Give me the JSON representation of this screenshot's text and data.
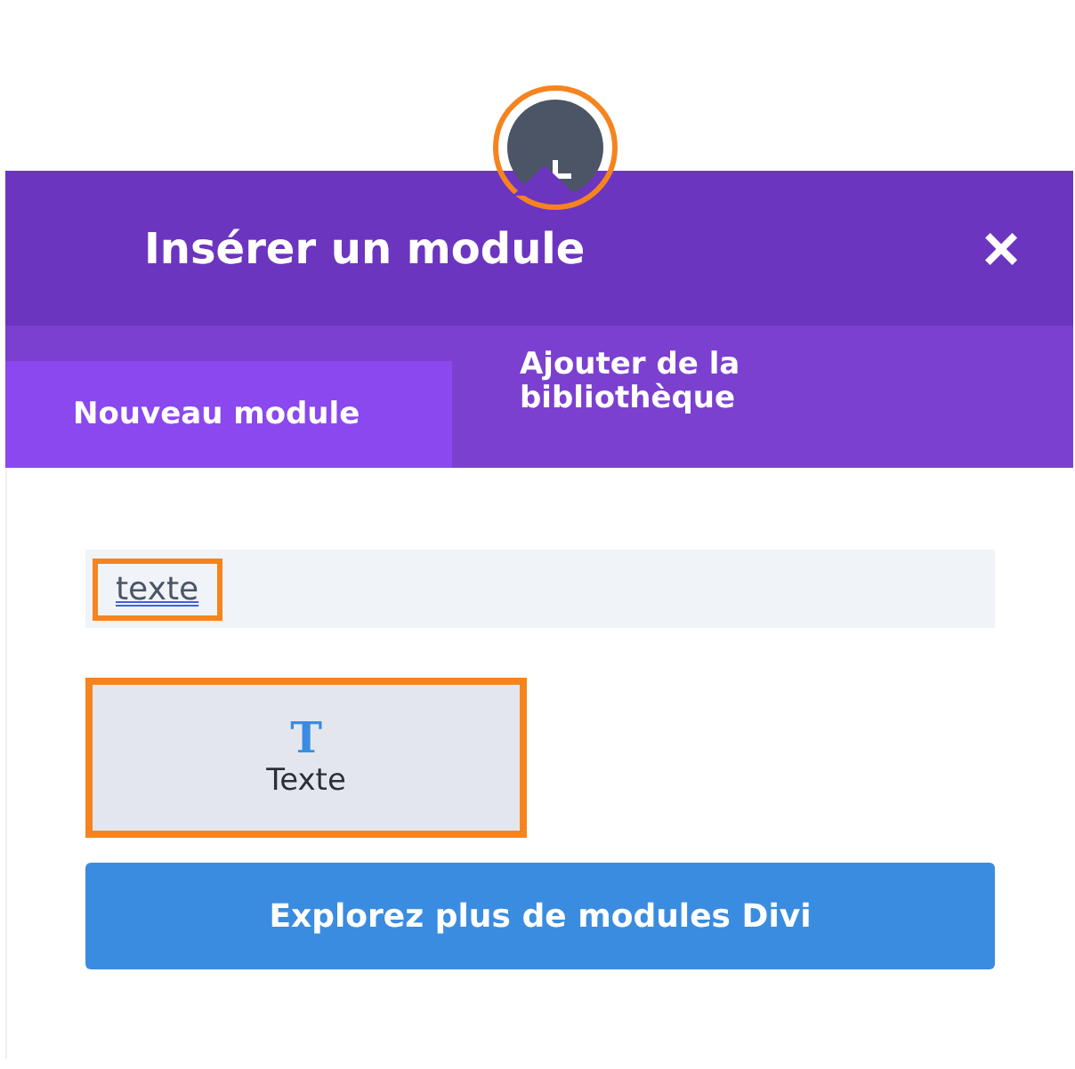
{
  "add_button": {
    "highlighted": true
  },
  "dialog": {
    "title": "Insérer un module",
    "close": "×"
  },
  "tabs": [
    {
      "label": "Nouveau module",
      "selected": true
    },
    {
      "label": "Ajouter de la bibliothèque",
      "selected": false
    }
  ],
  "search": {
    "value": "texte",
    "highlighted": true
  },
  "modules": [
    {
      "label": "Texte",
      "icon": "T",
      "highlighted": true
    }
  ],
  "explore_button": {
    "label": "Explorez plus de modules Divi"
  }
}
